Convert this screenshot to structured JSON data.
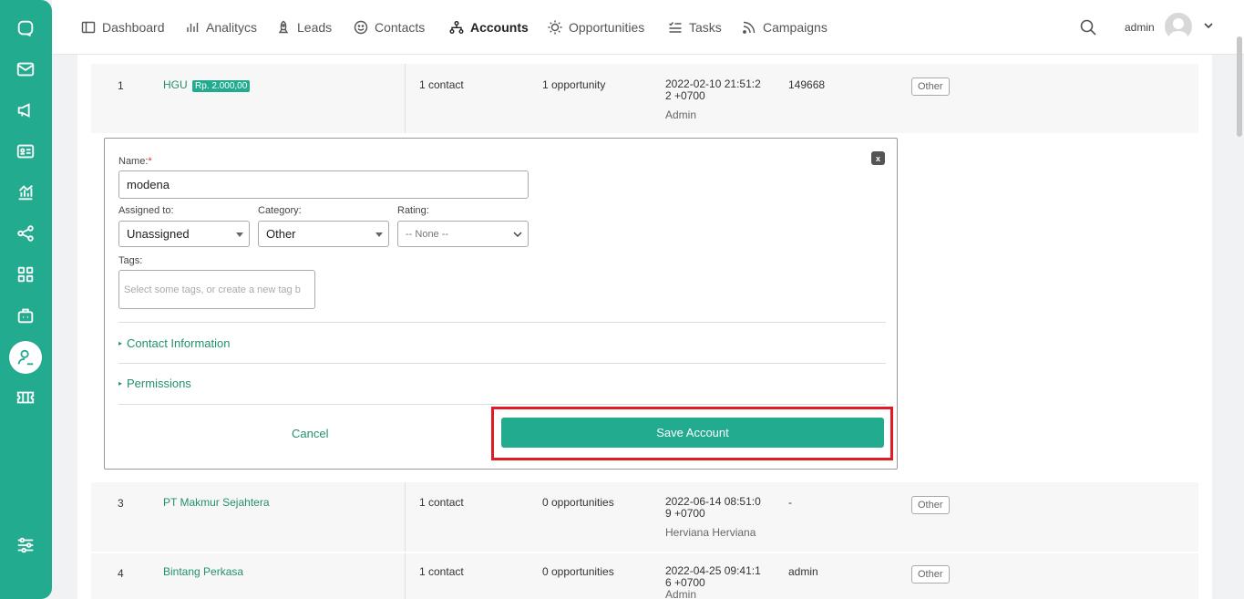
{
  "nav": {
    "items": [
      {
        "label": "Dashboard",
        "icon": "dashboard-icon"
      },
      {
        "label": "Analitycs",
        "icon": "bar-chart-icon"
      },
      {
        "label": "Leads",
        "icon": "rocket-icon"
      },
      {
        "label": "Contacts",
        "icon": "smiley-icon"
      },
      {
        "label": "Accounts",
        "icon": "hierarchy-icon",
        "active": true
      },
      {
        "label": "Opportunities",
        "icon": "sun-icon"
      },
      {
        "label": "Tasks",
        "icon": "checklist-icon"
      },
      {
        "label": "Campaigns",
        "icon": "rss-icon"
      }
    ],
    "user": "admin"
  },
  "sidebar": {
    "icons": [
      "chat-icon",
      "mail-icon",
      "megaphone-icon",
      "id-card-icon",
      "chart-icon",
      "share-icon",
      "apps-icon",
      "robot-icon",
      "user-icon",
      "ticket-icon",
      "settings-sliders-icon"
    ],
    "active": "user-icon"
  },
  "rows": [
    {
      "num": "1",
      "name": "HGU",
      "price": "Rp. 2.000,00",
      "contacts": "1 contact",
      "opportunities": "1 opportunity",
      "date": "2022-02-10 21:51:2",
      "date2": "2 +0700",
      "user": "Admin",
      "phone": "149668",
      "category": "Other"
    },
    {
      "num": "3",
      "name": "PT Makmur Sejahtera",
      "contacts": "1 contact",
      "opportunities": "0 opportunities",
      "date": "2022-06-14 08:51:0",
      "date2": "9 +0700",
      "user": "Herviana Herviana",
      "phone": "-",
      "category": "Other"
    },
    {
      "num": "4",
      "name": "Bintang Perkasa",
      "contacts": "1 contact",
      "opportunities": "0 opportunities",
      "date": "2022-04-25 09:41:1",
      "date2": "6 +0700",
      "user": "Admin",
      "phone": "admin",
      "category": "Other"
    }
  ],
  "form": {
    "close_label": "x",
    "name_label": "Name:",
    "required_mark": "*",
    "name_value": "modena",
    "assigned_label": "Assigned to:",
    "assigned_value": "Unassigned",
    "category_label": "Category:",
    "category_value": "Other",
    "rating_label": "Rating:",
    "rating_value": "-- None --",
    "tags_label": "Tags:",
    "tags_placeholder": "Select some tags, or create a new tag b",
    "contact_info": "Contact Information",
    "permissions": "Permissions",
    "cancel": "Cancel",
    "save": "Save Account"
  },
  "colors": {
    "accent": "#22ab8f",
    "highlight": "#e01b24"
  }
}
